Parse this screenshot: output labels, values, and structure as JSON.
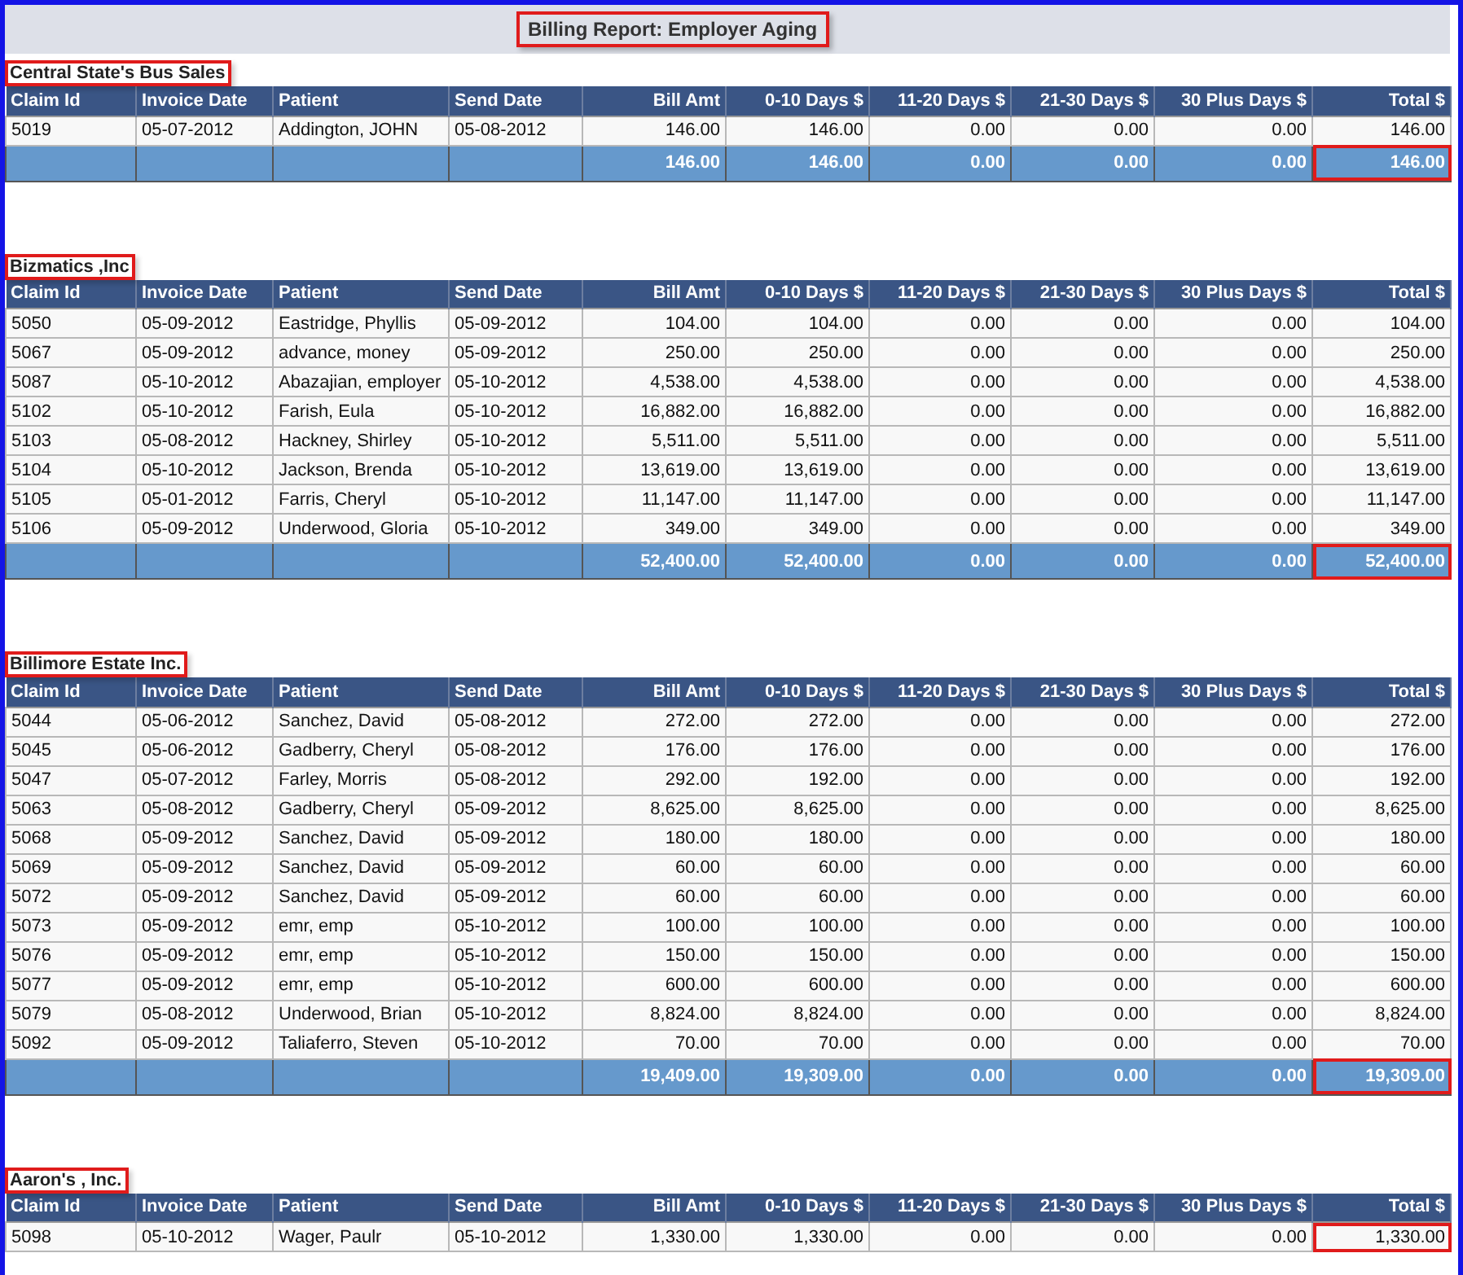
{
  "title": "Billing Report: Employer Aging",
  "groups": [
    {
      "name": "Central State's Bus Sales",
      "columns": [
        "Claim Id",
        "Invoice Date",
        "Patient",
        "Send Date",
        "Bill Amt",
        "0-10 Days $",
        "11-20 Days $",
        "21-30 Days $",
        "30 Plus Days $",
        "Total $"
      ],
      "rows": [
        [
          "5019",
          "05-07-2012",
          "Addington, JOHN",
          "05-08-2012",
          "146.00",
          "146.00",
          "0.00",
          "0.00",
          "0.00",
          "146.00"
        ]
      ],
      "totals": [
        "146.00",
        "146.00",
        "0.00",
        "0.00",
        "0.00",
        "146.00"
      ]
    },
    {
      "name": "Bizmatics ,Inc",
      "columns": [
        "Claim Id",
        "Invoice Date",
        "Patient",
        "Send Date",
        "Bill Amt",
        "0-10 Days $",
        "11-20 Days $",
        "21-30 Days $",
        "30 Plus Days $",
        "Total $"
      ],
      "rows": [
        [
          "5050",
          "05-09-2012",
          "Eastridge, Phyllis",
          "05-09-2012",
          "104.00",
          "104.00",
          "0.00",
          "0.00",
          "0.00",
          "104.00"
        ],
        [
          "5067",
          "05-09-2012",
          "advance, money",
          "05-09-2012",
          "250.00",
          "250.00",
          "0.00",
          "0.00",
          "0.00",
          "250.00"
        ],
        [
          "5087",
          "05-10-2012",
          "Abazajian, employer",
          "05-10-2012",
          "4,538.00",
          "4,538.00",
          "0.00",
          "0.00",
          "0.00",
          "4,538.00"
        ],
        [
          "5102",
          "05-10-2012",
          "Farish, Eula",
          "05-10-2012",
          "16,882.00",
          "16,882.00",
          "0.00",
          "0.00",
          "0.00",
          "16,882.00"
        ],
        [
          "5103",
          "05-08-2012",
          "Hackney, Shirley",
          "05-10-2012",
          "5,511.00",
          "5,511.00",
          "0.00",
          "0.00",
          "0.00",
          "5,511.00"
        ],
        [
          "5104",
          "05-10-2012",
          "Jackson, Brenda",
          "05-10-2012",
          "13,619.00",
          "13,619.00",
          "0.00",
          "0.00",
          "0.00",
          "13,619.00"
        ],
        [
          "5105",
          "05-01-2012",
          "Farris, Cheryl",
          "05-10-2012",
          "11,147.00",
          "11,147.00",
          "0.00",
          "0.00",
          "0.00",
          "11,147.00"
        ],
        [
          "5106",
          "05-09-2012",
          "Underwood, Gloria",
          "05-10-2012",
          "349.00",
          "349.00",
          "0.00",
          "0.00",
          "0.00",
          "349.00"
        ]
      ],
      "totals": [
        "52,400.00",
        "52,400.00",
        "0.00",
        "0.00",
        "0.00",
        "52,400.00"
      ]
    },
    {
      "name": "Billimore Estate Inc.",
      "columns": [
        "Claim Id",
        "Invoice Date",
        "Patient",
        "Send Date",
        "Bill Amt",
        "0-10 Days $",
        "11-20 Days $",
        "21-30 Days $",
        "30 Plus Days $",
        "Total $"
      ],
      "rows": [
        [
          "5044",
          "05-06-2012",
          "Sanchez, David",
          "05-08-2012",
          "272.00",
          "272.00",
          "0.00",
          "0.00",
          "0.00",
          "272.00"
        ],
        [
          "5045",
          "05-06-2012",
          "Gadberry, Cheryl",
          "05-08-2012",
          "176.00",
          "176.00",
          "0.00",
          "0.00",
          "0.00",
          "176.00"
        ],
        [
          "5047",
          "05-07-2012",
          "Farley, Morris",
          "05-08-2012",
          "292.00",
          "192.00",
          "0.00",
          "0.00",
          "0.00",
          "192.00"
        ],
        [
          "5063",
          "05-08-2012",
          "Gadberry, Cheryl",
          "05-09-2012",
          "8,625.00",
          "8,625.00",
          "0.00",
          "0.00",
          "0.00",
          "8,625.00"
        ],
        [
          "5068",
          "05-09-2012",
          "Sanchez, David",
          "05-09-2012",
          "180.00",
          "180.00",
          "0.00",
          "0.00",
          "0.00",
          "180.00"
        ],
        [
          "5069",
          "05-09-2012",
          "Sanchez, David",
          "05-09-2012",
          "60.00",
          "60.00",
          "0.00",
          "0.00",
          "0.00",
          "60.00"
        ],
        [
          "5072",
          "05-09-2012",
          "Sanchez, David",
          "05-09-2012",
          "60.00",
          "60.00",
          "0.00",
          "0.00",
          "0.00",
          "60.00"
        ],
        [
          "5073",
          "05-09-2012",
          "emr, emp",
          "05-10-2012",
          "100.00",
          "100.00",
          "0.00",
          "0.00",
          "0.00",
          "100.00"
        ],
        [
          "5076",
          "05-09-2012",
          "emr, emp",
          "05-10-2012",
          "150.00",
          "150.00",
          "0.00",
          "0.00",
          "0.00",
          "150.00"
        ],
        [
          "5077",
          "05-09-2012",
          "emr, emp",
          "05-10-2012",
          "600.00",
          "600.00",
          "0.00",
          "0.00",
          "0.00",
          "600.00"
        ],
        [
          "5079",
          "05-08-2012",
          "Underwood, Brian",
          "05-10-2012",
          "8,824.00",
          "8,824.00",
          "0.00",
          "0.00",
          "0.00",
          "8,824.00"
        ],
        [
          "5092",
          "05-09-2012",
          "Taliaferro, Steven",
          "05-10-2012",
          "70.00",
          "70.00",
          "0.00",
          "0.00",
          "0.00",
          "70.00"
        ]
      ],
      "totals": [
        "19,409.00",
        "19,309.00",
        "0.00",
        "0.00",
        "0.00",
        "19,309.00"
      ]
    },
    {
      "name": "Aaron's , Inc.",
      "columns": [
        "Claim Id",
        "Invoice Date",
        "Patient",
        "Send Date",
        "Bill Amt",
        "0-10 Days $",
        "11-20 Days $",
        "21-30 Days $",
        "30 Plus Days $",
        "Total $"
      ],
      "rows": [
        [
          "5098",
          "05-10-2012",
          "Wager, Paulr",
          "05-10-2012",
          "1,330.00",
          "1,330.00",
          "0.00",
          "0.00",
          "0.00",
          "1,330.00"
        ]
      ]
    }
  ]
}
